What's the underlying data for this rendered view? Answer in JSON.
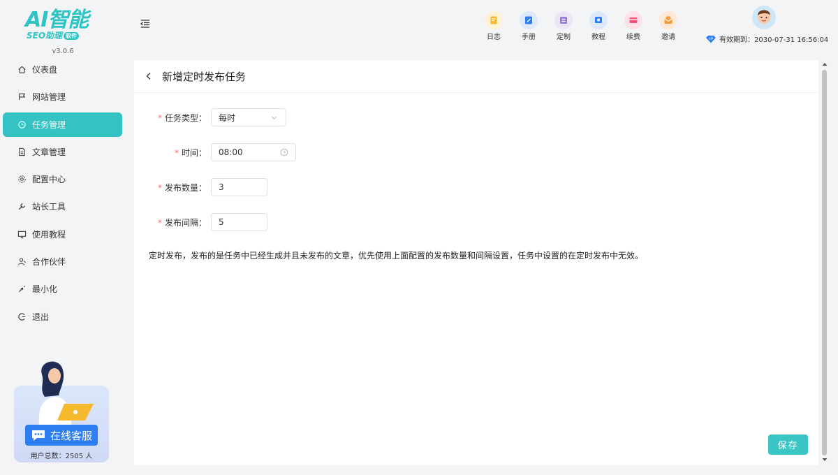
{
  "app": {
    "logo_main": "AI智能",
    "logo_sub": "SEO助理",
    "logo_badge": "软件",
    "version": "v3.0.6"
  },
  "sidebar": {
    "items": [
      {
        "label": "仪表盘",
        "icon": "home-icon"
      },
      {
        "label": "网站管理",
        "icon": "flag-icon"
      },
      {
        "label": "任务管理",
        "icon": "clock-icon",
        "active": true
      },
      {
        "label": "文章管理",
        "icon": "document-icon"
      },
      {
        "label": "配置中心",
        "icon": "gear-icon"
      },
      {
        "label": "站长工具",
        "icon": "wrench-icon"
      },
      {
        "label": "使用教程",
        "icon": "monitor-icon"
      },
      {
        "label": "合作伙伴",
        "icon": "partner-icon"
      },
      {
        "label": "最小化",
        "icon": "minimize-icon"
      },
      {
        "label": "退出",
        "icon": "logout-icon"
      }
    ],
    "support_label": "在线客服",
    "user_count": "用户总数：2505 人"
  },
  "toolbar": {
    "tools": [
      {
        "label": "日志",
        "icon": "log-icon",
        "color": "#f5b82e",
        "bg": "#fdf1d6"
      },
      {
        "label": "手册",
        "icon": "manual-icon",
        "color": "#2d7ef0",
        "bg": "#dde9fb"
      },
      {
        "label": "定制",
        "icon": "custom-icon",
        "color": "#9b7bd8",
        "bg": "#ece5f8"
      },
      {
        "label": "教程",
        "icon": "tutorial-icon",
        "color": "#2d7ef0",
        "bg": "#dde9fb"
      },
      {
        "label": "续费",
        "icon": "renew-icon",
        "color": "#f0567c",
        "bg": "#fde0e8"
      },
      {
        "label": "邀请",
        "icon": "invite-icon",
        "color": "#f59a3c",
        "bg": "#fde9d6"
      }
    ],
    "vip_text": "有效期到：2030-07-31 16:56:04"
  },
  "page": {
    "title": "新增定时发布任务",
    "fields": {
      "task_type": {
        "label": "任务类型：",
        "value": "每时"
      },
      "time": {
        "label": "时间：",
        "value": "08:00"
      },
      "publish_count": {
        "label": "发布数量：",
        "value": "3"
      },
      "publish_interval": {
        "label": "发布间隔：",
        "value": "5"
      }
    },
    "required_mark": "*",
    "note": "定时发布，发布的是任务中已经生成并且未发布的文章，优先使用上面配置的发布数量和间隔设置，任务中设置的在定时发布中无效。",
    "save_label": "保存"
  },
  "colors": {
    "accent": "#35c2c2",
    "required": "#f56c6c",
    "support_button": "#2d7ef0"
  }
}
